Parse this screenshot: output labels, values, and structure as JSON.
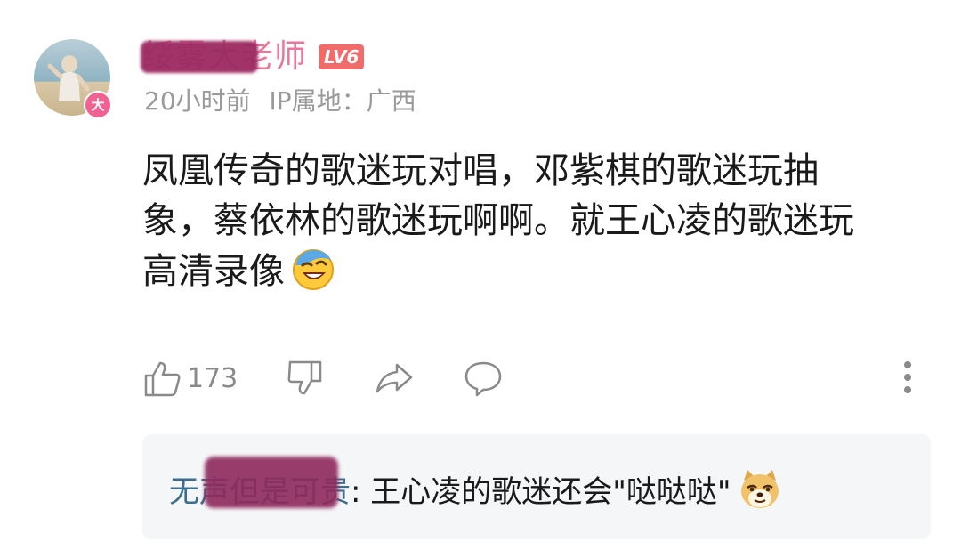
{
  "comment": {
    "username": "绥雾大老师",
    "level": "LV6",
    "vip_badge": "大",
    "time": "20小时前",
    "ip_label": "IP属地：",
    "ip_location": "广西",
    "lines": [
      "凤凰传奇的歌迷玩对唱，邓紫棋的歌迷玩抽",
      "象，蔡依林的歌迷玩啊啊。就王心凌的歌迷玩",
      "高清录像"
    ],
    "emoji": "laughing-crying-icon",
    "likes": "173"
  },
  "reply": {
    "username": "无声但是可贵",
    "separator": ":",
    "text": " 王心凌的歌迷还会\"哒哒哒\"",
    "emoji": "doge-icon"
  },
  "colors": {
    "username": "#e8779a",
    "level_badge": "#f26b6b",
    "reply_user": "#3b6e8f",
    "meta": "#9a9a9a"
  }
}
